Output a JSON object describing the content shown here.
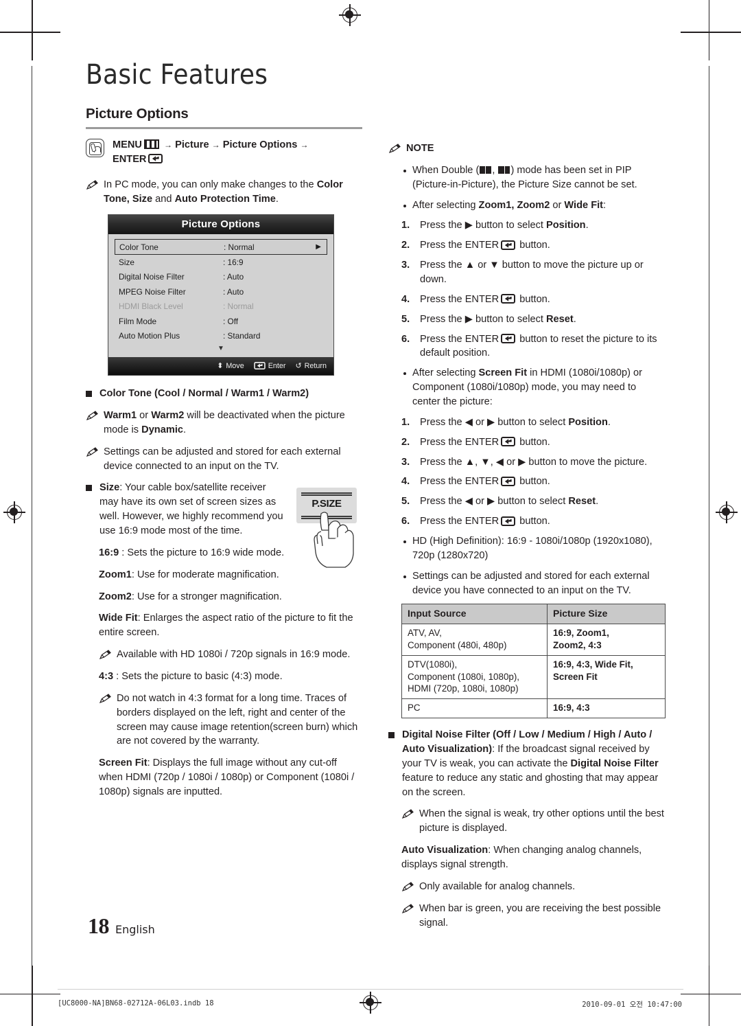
{
  "document": {
    "chapter_title": "Basic Features",
    "page_number": "18",
    "language": "English",
    "print_footer_left": "[UC8000-NA]BN68-02712A-06L03.indb   18",
    "print_footer_right": "2010-09-01   오전 10:47:00"
  },
  "left_column": {
    "section_heading": "Picture Options",
    "menu_path": {
      "menu_label": "MENU",
      "arrow": "→",
      "step1": "Picture",
      "step2": "Picture Options",
      "enter_label": "ENTER"
    },
    "pc_mode_note": "In PC mode, you can only make changes to the Color Tone, Size and Auto Protection Time.",
    "pc_mode_note_parts": {
      "pre": "In PC mode, you can only make changes to the ",
      "bold1": "Color Tone, Size",
      "mid": " and ",
      "bold2": "Auto Protection Time",
      "post": "."
    },
    "osd": {
      "title": "Picture Options",
      "rows": [
        {
          "label": "Color Tone",
          "value": ": Normal",
          "selected": true,
          "dim": false,
          "caret": "▶"
        },
        {
          "label": "Size",
          "value": ": 16:9",
          "selected": false,
          "dim": false,
          "caret": ""
        },
        {
          "label": "Digital Noise Filter",
          "value": ": Auto",
          "selected": false,
          "dim": false,
          "caret": ""
        },
        {
          "label": "MPEG Noise Filter",
          "value": ": Auto",
          "selected": false,
          "dim": false,
          "caret": ""
        },
        {
          "label": "HDMI Black Level",
          "value": ": Normal",
          "selected": false,
          "dim": true,
          "caret": ""
        },
        {
          "label": "Film Mode",
          "value": ": Off",
          "selected": false,
          "dim": false,
          "caret": ""
        },
        {
          "label": "Auto Motion Plus",
          "value": ": Standard",
          "selected": false,
          "dim": false,
          "caret": ""
        }
      ],
      "scroll_down_glyph": "▼",
      "footer": {
        "move": "Move",
        "enter": "Enter",
        "return": "Return",
        "move_glyph": "⬍",
        "return_glyph": "↺"
      }
    },
    "color_tone_heading": "Color Tone (Cool / Normal / Warm1 / Warm2)",
    "color_tone_notes": [
      {
        "pre": "",
        "bold1": "Warm1",
        "mid1": " or ",
        "bold2": "Warm2",
        "mid2": " will be deactivated when the picture mode is ",
        "bold3": "Dynamic",
        "post": "."
      }
    ],
    "external_device_note": "Settings can be adjusted and stored for each external device connected to an input on the TV.",
    "size_heading_bold": "Size",
    "size_heading_rest": ": Your cable box/satellite receiver may have its own set of screen sizes as well. However, we highly recommend you use 16:9 mode most of the time.",
    "remote_key_label": "P.SIZE",
    "size_options": [
      {
        "name": "16:9",
        "sep": " : ",
        "desc": "Sets the picture to 16:9 wide mode."
      },
      {
        "name": "Zoom1",
        "sep": ": ",
        "desc": "Use for moderate magnification."
      },
      {
        "name": "Zoom2",
        "sep": ": ",
        "desc": "Use for a stronger magnification."
      },
      {
        "name": "Wide Fit",
        "sep": ": ",
        "desc": "Enlarges the aspect ratio of the picture to fit the entire screen."
      }
    ],
    "wide_fit_note": "Available with HD 1080i / 720p signals in 16:9 mode.",
    "ratio43": {
      "name": "4:3",
      "sep": " : ",
      "desc": "Sets the picture to basic (4:3) mode."
    },
    "ratio43_note": "Do not watch in 4:3 format for a long time. Traces of borders displayed on the left, right and center of the screen may cause image retention(screen burn) which are not covered by the warranty.",
    "screen_fit": {
      "name": "Screen Fit",
      "desc": ": Displays the full image without any cut-off when HDMI (720p / 1080i / 1080p) or Component (1080i / 1080p) signals are inputted."
    }
  },
  "right_column": {
    "note_title": "NOTE",
    "note_double": {
      "pre": "When Double (",
      "mid": ", ",
      "post": ") mode has been set in PIP (Picture-in-Picture), the Picture Size cannot be set."
    },
    "note_after_zoom": {
      "pre": "After selecting ",
      "bold": "Zoom1, Zoom2",
      "mid": " or ",
      "bold2": "Wide Fit",
      "post": ":"
    },
    "zoom_steps": [
      {
        "num": "1.",
        "pre": "Press the ▶ button to select ",
        "bold": "Position",
        "post": "."
      },
      {
        "num": "2.",
        "pre": "Press the ENTER",
        "bold": "",
        "post": " button."
      },
      {
        "num": "3.",
        "pre": "Press the ▲ or ▼ button to move the picture up or down.",
        "bold": "",
        "post": ""
      },
      {
        "num": "4.",
        "pre": "Press the ENTER",
        "bold": "",
        "post": " button."
      },
      {
        "num": "5.",
        "pre": "Press the ▶ button to select ",
        "bold": "Reset",
        "post": "."
      },
      {
        "num": "6.",
        "pre": "Press the ENTER",
        "bold": "",
        "post": " button to reset the picture to its default position."
      }
    ],
    "note_screen_fit": {
      "pre": "After selecting ",
      "bold": "Screen Fit",
      "post": " in HDMI (1080i/1080p) or Component (1080i/1080p) mode, you may need to center the picture:"
    },
    "screenfit_steps": [
      {
        "num": "1.",
        "pre": "Press the ◀ or ▶ button to select ",
        "bold": "Position",
        "post": "."
      },
      {
        "num": "2.",
        "pre": "Press the ENTER",
        "bold": "",
        "post": " button."
      },
      {
        "num": "3.",
        "pre": "Press the ▲, ▼, ◀ or ▶ button to move the picture.",
        "bold": "",
        "post": ""
      },
      {
        "num": "4.",
        "pre": "Press the ENTER",
        "bold": "",
        "post": " button."
      },
      {
        "num": "5.",
        "pre": "Press the ◀ or ▶ button to select ",
        "bold": "Reset",
        "post": "."
      },
      {
        "num": "6.",
        "pre": "Press the ENTER",
        "bold": "",
        "post": " button."
      }
    ],
    "note_hd": "HD (High Definition): 16:9 - 1080i/1080p (1920x1080), 720p (1280x720)",
    "note_settings_stored": "Settings can be adjusted and stored for each external device you have connected to an input on the TV),",
    "note_settings_stored_text": "Settings can be adjusted and stored for each external device you have connected to an input on the TV.",
    "table": {
      "headers": [
        "Input Source",
        "Picture Size"
      ],
      "rows": [
        {
          "source": "ATV, AV,\nComponent (480i, 480p)",
          "size": "16:9, Zoom1,\nZoom2, 4:3"
        },
        {
          "source": "DTV(1080i),\nComponent (1080i, 1080p),\nHDMI (720p, 1080i, 1080p)",
          "size": "16:9, 4:3, Wide Fit,\nScreen Fit"
        },
        {
          "source": "PC",
          "size": "16:9, 4:3"
        }
      ]
    },
    "dnf": {
      "bold": "Digital Noise Filter (Off / Low / Medium / High / Auto / Auto Visualization)",
      "mid": ": If the broadcast signal received by your TV is weak, you can activate the ",
      "bold2": "Digital Noise Filter",
      "post": " feature to reduce any static and ghosting that may appear on the screen."
    },
    "dnf_note": "When the signal is weak, try other options until the best picture is displayed.",
    "auto_vis": {
      "bold": "Auto Visualization",
      "post": ": When changing analog channels, displays signal strength."
    },
    "auto_vis_notes": [
      "Only available for analog channels.",
      "When bar is green, you are receiving the best possible signal."
    ]
  }
}
